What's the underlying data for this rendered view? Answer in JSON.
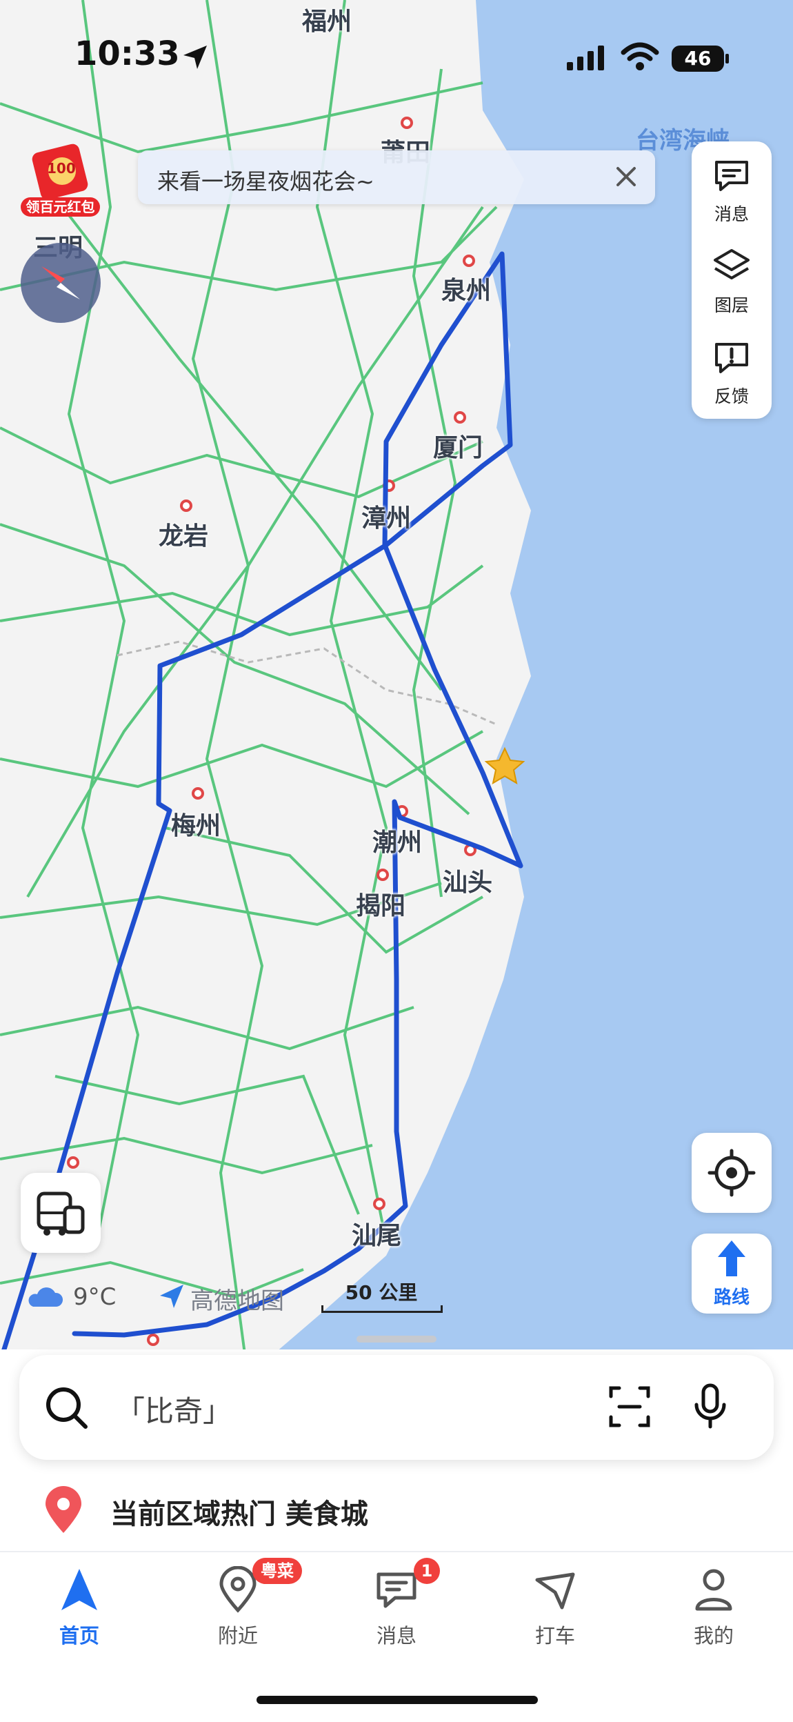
{
  "status_bar": {
    "time": "10:33",
    "battery": "46"
  },
  "banner": {
    "text": "来看一场星夜烟花会~"
  },
  "red_packet": {
    "amount": "100",
    "label": "领百元红包"
  },
  "right_panel": [
    {
      "label": "消息",
      "icon": "message-icon"
    },
    {
      "label": "图层",
      "icon": "layers-icon"
    },
    {
      "label": "反馈",
      "icon": "feedback-icon"
    }
  ],
  "map_labels": {
    "fuzhou": "福州",
    "putian": "莆田",
    "sanming": "三明",
    "quanzhou": "泉州",
    "xiamen": "厦门",
    "zhangzhou": "漳州",
    "longyan": "龙岩",
    "meizhou": "梅州",
    "chaozhou": "潮州",
    "shantou": "汕头",
    "jieyang": "揭阳",
    "shanwei": "汕尾",
    "taiwan_strait": "台湾海峡"
  },
  "route_button": {
    "label": "路线"
  },
  "weather": {
    "temp": "9°C"
  },
  "map_logo": {
    "name": "高德地图"
  },
  "scale": {
    "label": "50 公里"
  },
  "search": {
    "placeholder": "「比奇」"
  },
  "hot_area": {
    "text": "当前区域热门 美食城"
  },
  "tabs": [
    {
      "label": "首页",
      "icon": "navigation-arrow-icon",
      "active": true
    },
    {
      "label": "附近",
      "icon": "location-pin-icon",
      "badge": "粤菜"
    },
    {
      "label": "消息",
      "icon": "chat-icon",
      "badge": "1"
    },
    {
      "label": "打车",
      "icon": "taxi-icon"
    },
    {
      "label": "我的",
      "icon": "person-icon"
    }
  ],
  "colors": {
    "accent": "#1f6ff0",
    "route": "#1f4fcf",
    "sea": "#a7c9f2",
    "road": "#3fbf6a",
    "badge": "#f0403c"
  }
}
